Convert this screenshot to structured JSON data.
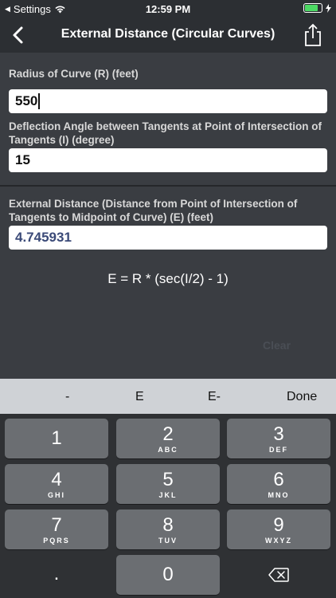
{
  "status": {
    "carrier": "Settings",
    "time": "12:59 PM",
    "battery_level": 0.9
  },
  "nav": {
    "title": "External Distance (Circular Curves)",
    "back_icon": "chevron-left-icon",
    "share_icon": "share-icon"
  },
  "form": {
    "radius_label": "Radius of Curve (R) (feet)",
    "radius_value": "550",
    "angle_label": "Deflection Angle between Tangents at Point of Intersection of Tangents (I) (degree)",
    "angle_value": "15",
    "result_label": "External Distance (Distance from Point of Intersection of Tangents to Midpoint of Curve) (E) (feet)",
    "result_value": "4.745931",
    "formula": "E = R * (sec(I/2) - 1)",
    "clear_label": "Clear"
  },
  "accessory": {
    "minus": "-",
    "exp": "E",
    "exp_neg": "E-",
    "done": "Done"
  },
  "keypad": {
    "k1": "1",
    "k2": "2",
    "k2_letters": "ABC",
    "k3": "3",
    "k3_letters": "DEF",
    "k4": "4",
    "k4_letters": "GHI",
    "k5": "5",
    "k5_letters": "JKL",
    "k6": "6",
    "k6_letters": "MNO",
    "k7": "7",
    "k7_letters": "PQRS",
    "k8": "8",
    "k8_letters": "TUV",
    "k9": "9",
    "k9_letters": "WXYZ",
    "dot": ".",
    "k0": "0",
    "delete_icon": "backspace-icon"
  }
}
